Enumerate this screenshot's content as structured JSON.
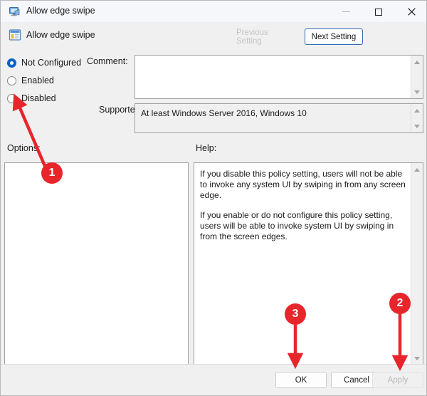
{
  "window": {
    "title": "Allow edge swipe",
    "icon": "monitor-policy-icon",
    "controls": {
      "minimize": "minimize-icon",
      "maximize": "maximize-icon",
      "close": "close-icon"
    }
  },
  "header": {
    "policy_name": "Allow edge swipe",
    "policy_icon": "group-policy-setting-icon",
    "previous_setting_label": "Previous Setting",
    "previous_setting_enabled": false,
    "next_setting_label": "Next Setting",
    "next_setting_enabled": true
  },
  "state_options": [
    {
      "label": "Not Configured",
      "selected": true
    },
    {
      "label": "Enabled",
      "selected": false
    },
    {
      "label": "Disabled",
      "selected": false
    }
  ],
  "comment": {
    "label": "Comment:",
    "value": "",
    "placeholder": ""
  },
  "supported_on": {
    "label": "Supported on:",
    "value": "At least Windows Server 2016, Windows 10"
  },
  "options": {
    "label": "Options:",
    "value": ""
  },
  "help": {
    "label": "Help:",
    "paragraphs": [
      "If you disable this policy setting, users will not be able to invoke any system UI by swiping in from any screen edge.",
      "If you enable or do not configure this policy setting, users will be able to invoke system UI by swiping in from the screen edges."
    ]
  },
  "dialog_buttons": {
    "ok_label": "OK",
    "cancel_label": "Cancel",
    "apply_label": "Apply",
    "apply_enabled": false
  },
  "annotations": {
    "accent_color": "#e8252a",
    "markers": [
      {
        "number": "1",
        "target": "disabled-radio"
      },
      {
        "number": "2",
        "target": "apply-button"
      },
      {
        "number": "3",
        "target": "ok-button"
      }
    ]
  }
}
